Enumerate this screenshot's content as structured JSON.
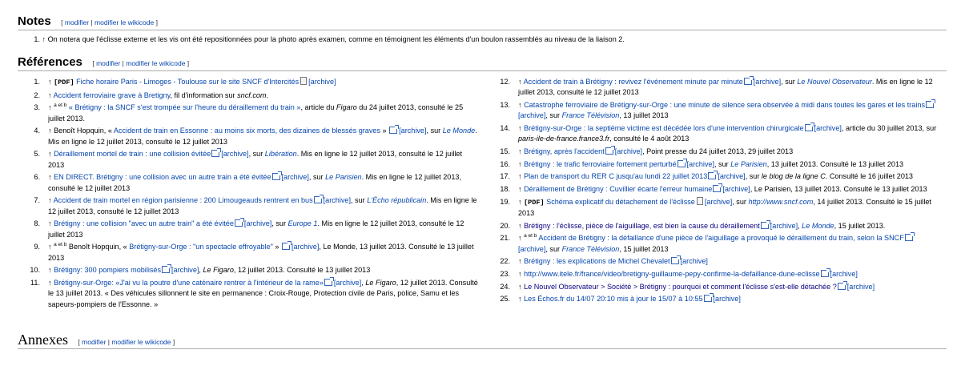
{
  "notes": {
    "title": "Notes",
    "edit_links": [
      "modifier",
      "modifier le wikicode"
    ],
    "items": [
      {
        "num": "1.",
        "arrow": "↑",
        "text": "On notera que l'éclisse externe et les vis ont été repositionnées pour la photo après examen, comme en témoignent les éléments d'un boulon rassemblés au niveau de la liaison 2."
      }
    ]
  },
  "references": {
    "title": "Références",
    "edit_links": [
      "modifier",
      "modifier le wikicode"
    ],
    "archive_label": "[archive]",
    "pdf_label": "[PDF]",
    "left_column": [
      {
        "num": "1.",
        "arrow": "↑",
        "pdf": "[PDF]",
        "link": "Fiche horaire Paris - Limoges - Toulouse sur le site SNCF d'Intercités",
        "after": ""
      },
      {
        "num": "2.",
        "arrow": "↑",
        "link": "Accident ferroviaire grave à Bretigny",
        "after": ", fil d'information sur ",
        "italic": "sncf.com",
        "tail": "."
      },
      {
        "num": "3.",
        "arrow": "↑",
        "sup": "a et b",
        "link": "« Brétigny : la SNCF s'est trompée sur l'heure du déraillement du train »",
        "after": ", article du ",
        "italic": "Figaro",
        "tail": " du 24 juillet 2013, consulté le 25 juillet 2013."
      },
      {
        "num": "4.",
        "arrow": "↑",
        "pre": "Benoît Hopquin, « ",
        "link": "Accident de train en Essonne : au moins six morts, des dizaines de blessés graves",
        "after": " » ",
        "archive_after": ", sur ",
        "italic_link": "Le Monde",
        "tail": ". Mis en ligne le 12 juillet 2013, consulté le 12 juillet 2013"
      },
      {
        "num": "5.",
        "arrow": "↑",
        "link": "Déraillement mortel de train : une collision évitée",
        "archive_after": ", sur ",
        "italic_link": "Libération",
        "tail": ". Mis en ligne le 12 juillet 2013, consulté le 12 juillet 2013"
      },
      {
        "num": "6.",
        "arrow": "↑",
        "link": "EN DIRECT. Brétigny : une collision avec un autre train a été évitée",
        "archive_after": ", sur ",
        "italic_link": "Le Parisien",
        "tail": ". Mis en ligne le 12 juillet 2013, consulté le 12 juillet 2013"
      },
      {
        "num": "7.",
        "arrow": "↑",
        "link": "Accident de train mortel en région parisienne : 200 Limougeauds rentrent en bus",
        "archive_after": ", sur ",
        "italic_link": "L'Écho républicain",
        "tail": ". Mis en ligne le 12 juillet 2013, consulté le 12 juillet 2013"
      },
      {
        "num": "8.",
        "arrow": "↑",
        "link": "Brétigny : une collision \"avec un autre train\" a été évitée",
        "archive_after": ", sur ",
        "italic_link": "Europe 1",
        "tail": ". Mis en ligne le 12 juillet 2013, consulté le 12 juillet 2013"
      },
      {
        "num": "9.",
        "arrow": "↑",
        "sup": "a et b",
        "pre": "Benoît Hopquin, « ",
        "link": "Brétigny-sur-Orge : \"un spectacle effroyable\"",
        "after": " » ",
        "archive_after": ", Le Monde, 13 juillet 2013. Consulté le 13 juillet 2013"
      },
      {
        "num": "10.",
        "arrow": "↑",
        "link": "Brétigny: 300 pompiers mobilisés",
        "archive_after": ", ",
        "italic": "Le Figaro",
        "tail": ", 12 juillet 2013. Consulté le 13 juillet 2013"
      },
      {
        "num": "11.",
        "arrow": "↑",
        "link": "Brétigny-sur-Orge: «J'ai vu la poutre d'une caténaire rentrer à l'intérieur de la rame»",
        "archive_after": ", ",
        "italic": "Le Figaro",
        "tail": ", 12 juillet 2013. Consulté le 13 juillet 2013. « Des véhicules sillonnent le site en permanence : Croix-Rouge, Protection civile de Paris, police, Samu et les sapeurs-pompiers de l'Essonne. »"
      }
    ],
    "right_column": [
      {
        "num": "12.",
        "arrow": "↑",
        "link": "Accident de train à Brétigny : revivez l'événement minute par minute",
        "archive_after": ", sur ",
        "italic_link": "Le Nouvel Observateur",
        "tail": ". Mis en ligne le 12 juillet 2013, consulté le 12 juillet 2013"
      },
      {
        "num": "13.",
        "arrow": "↑",
        "link": "Catastrophe ferroviaire de Brétigny-sur-Orge : une minute de silence sera observée à midi dans toutes les gares et les trains",
        "archive_after": ", sur ",
        "italic_link": "France Télévision",
        "tail": ", 13 juillet 2013"
      },
      {
        "num": "14.",
        "arrow": "↑",
        "link": "Brétigny-sur-Orge : la septième victime est décédée lors d'une intervention chirurgicale",
        "archive_after": ", article du 30 juillet 2013, sur ",
        "italic": "paris-ile-de-france.france3.fr",
        "tail": ", consulté le 4 août 2013"
      },
      {
        "num": "15.",
        "arrow": "↑",
        "link": "Brétigny, après l'accident",
        "archive_after": ", Point presse du 24 juillet 2013, 29 juillet 2013"
      },
      {
        "num": "16.",
        "arrow": "↑",
        "link": "Brétigny : le trafic ferroviaire fortement perturbé",
        "archive_after": ", sur ",
        "italic_link": "Le Parisien",
        "tail": ", 13 juillet 2013. Consulté le 13 juillet 2013"
      },
      {
        "num": "17.",
        "arrow": "↑",
        "link": "Plan de transport du RER C jusqu'au lundi 22 juillet 2013",
        "archive_after": ", sur ",
        "italic": "le blog de la ligne C",
        "tail": ". Consulté le 16 juillet 2013"
      },
      {
        "num": "18.",
        "arrow": "↑",
        "link": "Déraillement de Brétigny : Cuvillier écarte l'erreur humaine",
        "archive_after": ", Le Parisien, 13 juillet 2013. Consulté le 13 juillet 2013"
      },
      {
        "num": "19.",
        "arrow": "↑",
        "pdf": "[PDF]",
        "link": "Schéma explicatif du détachement de l'éclisse",
        "doc_archive": true,
        "archive_after": ", sur ",
        "italic_link": "http://www.sncf.com",
        "tail": ", 14 juillet 2013. Consulté le 15 juillet 2013"
      },
      {
        "num": "20.",
        "arrow": "↑",
        "visited": true,
        "link": "Brétigny : l'éclisse, pièce de l'aiguillage, est bien la cause du déraillement",
        "archive_after": ", ",
        "italic_link": "Le Monde",
        "tail": ", 15 juillet 2013."
      },
      {
        "num": "21.",
        "arrow": "↑",
        "sup": "a et b",
        "link": "Accident de Brétigny : la défaillance d'une pièce de l'aiguillage a provoqué le déraillement du train, selon la SNCF",
        "archive_after": ", sur ",
        "italic_link": "France Télévision",
        "tail": ", 15 juillet 2013"
      },
      {
        "num": "22.",
        "arrow": "↑",
        "link": "Brétigny : les explications de Michel Chevalet",
        "archive_after": ""
      },
      {
        "num": "23.",
        "arrow": "↑",
        "link": "http://www.itele.fr/france/video/bretigny-guillaume-pepy-confirme-la-defaillance-dune-eclisse",
        "archive_after": ""
      },
      {
        "num": "24.",
        "arrow": "↑",
        "visited": true,
        "link": "Le Nouvel Observateur > Société > Brétigny : pourquoi et comment l'éclisse s'est-elle détachée ?",
        "archive_after": ""
      },
      {
        "num": "25.",
        "arrow": "↑",
        "link": "Les Échos.fr du 14/07 20:10 mis à jour le 15/07 à 10:55",
        "archive_after": ""
      }
    ]
  },
  "annexes": {
    "title": "Annexes",
    "edit_links": [
      "modifier",
      "modifier le wikicode"
    ]
  }
}
